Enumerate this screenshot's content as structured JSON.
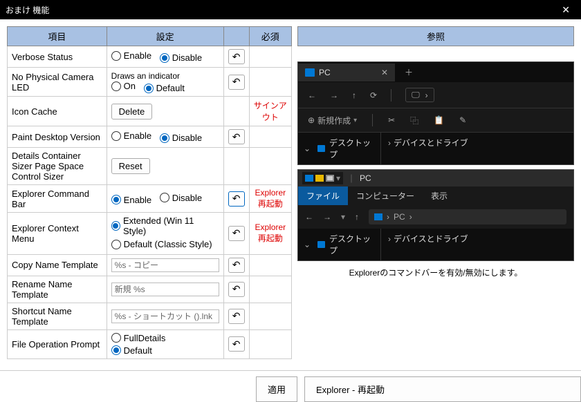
{
  "title": "おまけ 機能",
  "headers": {
    "item": "項目",
    "setting": "設定",
    "required": "必須",
    "reference": "参照"
  },
  "rows": {
    "verbose": {
      "label": "Verbose Status",
      "opt1": "Enable",
      "opt2": "Disable"
    },
    "camled": {
      "label": "No Physical Camera LED",
      "desc": "Draws an indicator",
      "opt1": "On",
      "opt2": "Default"
    },
    "iconcache": {
      "label": "Icon Cache",
      "btn": "Delete",
      "req": "サインアウト"
    },
    "paintver": {
      "label": "Paint Desktop Version",
      "opt1": "Enable",
      "opt2": "Disable"
    },
    "details": {
      "label": "Details Container Sizer Page Space Control Sizer",
      "btn": "Reset"
    },
    "cmdbar": {
      "label": "Explorer Command Bar",
      "opt1": "Enable",
      "opt2": "Disable",
      "req": "Explorer\n再起動"
    },
    "ctxmenu": {
      "label": "Explorer Context Menu",
      "opt1": "Extended (Win 11 Style)",
      "opt2": "Default (Classic Style)",
      "req": "Explorer\n再起動"
    },
    "copytpl": {
      "label": "Copy Name Template",
      "val": "%s - コピー"
    },
    "renametpl": {
      "label": "Rename Name Template",
      "val": "新規 %s"
    },
    "shortcuttpl": {
      "label": "Shortcut Name Template",
      "val": "%s - ショートカット ().lnk"
    },
    "fileop": {
      "label": "File Operation Prompt",
      "opt1": "FullDetails",
      "opt2": "Default"
    }
  },
  "buttons": {
    "apply": "適用",
    "restart": "Explorer - 再起動"
  },
  "preview": {
    "pc": "PC",
    "new": "新規作成",
    "desktop": "デスクトップ",
    "devices": "デバイスとドライブ",
    "file": "ファイル",
    "computer": "コンピューター",
    "view": "表示",
    "caption": "Explorerのコマンドバーを有効/無効にします。"
  }
}
